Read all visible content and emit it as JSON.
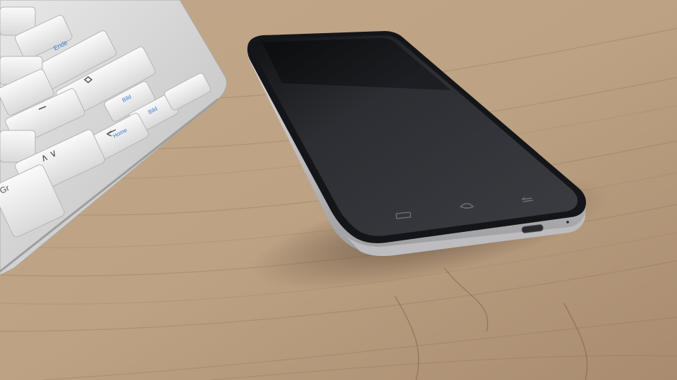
{
  "scene": {
    "description_tag": "",
    "colors": {
      "wood_light": "#c6ad8f",
      "wood_mid": "#b29477",
      "wood_dark": "#8a6d55",
      "keyboard_body": "#dcdcdc",
      "key_face": "#f2f2f2",
      "key_shadow": "#a9a9a9",
      "phone_glass": "#26282c",
      "phone_bezel": "#1a1b1e",
      "phone_frame": "#c9c9cb"
    },
    "keyboard": {
      "keys": [
        {
          "label": "",
          "icon": "blank"
        },
        {
          "label": "",
          "icon": "blank"
        },
        {
          "label": "Ende",
          "icon": "text"
        },
        {
          "label": "",
          "icon": "blank"
        },
        {
          "label": "",
          "icon": "blank"
        },
        {
          "label": "",
          "icon": "blank"
        },
        {
          "label": "Bild",
          "icon": "text"
        },
        {
          "label": "Bild",
          "icon": "text"
        },
        {
          "label": "",
          "icon": "blank"
        },
        {
          "label": "Home",
          "icon": "text"
        },
        {
          "label": "∧ ∨",
          "icon": "arrows"
        },
        {
          "label": "Gr",
          "icon": "text"
        }
      ]
    },
    "phone": {
      "nav_buttons": [
        "menu-icon",
        "home-icon",
        "back-icon"
      ],
      "port": "usb-port-icon"
    }
  }
}
